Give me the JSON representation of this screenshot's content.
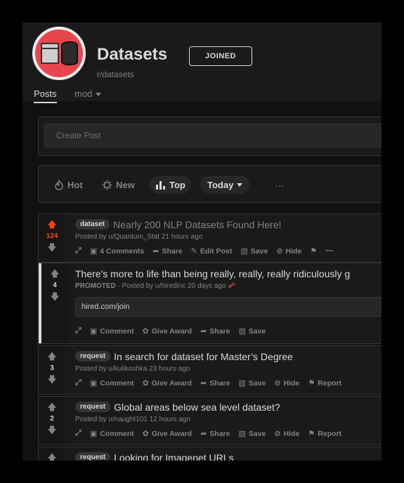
{
  "header": {
    "title": "Datasets",
    "subreddit": "r/datasets",
    "joined_label": "JOINED",
    "tabs": [
      {
        "label": "Posts"
      },
      {
        "label": "mod"
      }
    ]
  },
  "create_post": {
    "placeholder": "Create Post"
  },
  "sort": {
    "hot": "Hot",
    "new": "New",
    "top": "Top",
    "time": "Today",
    "more": "…"
  },
  "posts": [
    {
      "votes": "124",
      "flair": "dataset",
      "title": "Nearly 200 NLP Datasets Found Here!",
      "meta": "Posted by u/Quantum_Stat 21 hours ago",
      "actions": {
        "comments": "4 Comments",
        "share": "Share",
        "edit": "Edit Post",
        "save": "Save",
        "hide": "Hide"
      }
    },
    {
      "votes": "4",
      "title": "There's more to life than being really, really, really ridiculously g",
      "promoted": "PROMOTED",
      "meta": "· Posted by u/hiredinc 20 days ago",
      "link": "hired.com/join",
      "actions": {
        "comment": "Comment",
        "award": "Give Award",
        "share": "Share",
        "save": "Save"
      }
    },
    {
      "votes": "3",
      "flair": "request",
      "title": "In search for dataset for Master’s Degree",
      "meta": "Posted by u/kulikoshka 23 hours ago",
      "actions": {
        "comment": "Comment",
        "award": "Give Award",
        "share": "Share",
        "save": "Save",
        "hide": "Hide",
        "report": "Report"
      }
    },
    {
      "votes": "2",
      "flair": "request",
      "title": "Global areas below sea level dataset?",
      "meta": "Posted by u/naught101 12 hours ago",
      "actions": {
        "comment": "Comment",
        "award": "Give Award",
        "share": "Share",
        "save": "Save",
        "hide": "Hide",
        "report": "Report"
      }
    },
    {
      "flair": "request",
      "title": "Looking for Imagenet URLs"
    }
  ],
  "icons": [
    "subreddit-avatar-icon",
    "flame-icon",
    "new-icon",
    "top-icon",
    "upvote-icon",
    "downvote-icon",
    "expand-icon",
    "comment-icon",
    "share-icon",
    "edit-icon",
    "save-icon",
    "hide-icon",
    "tag-icon",
    "award-icon",
    "report-icon",
    "lock-icon"
  ],
  "colors": {
    "accent": "#ff4500",
    "background": "#1a1a1b",
    "text": "#d7dadc",
    "muted": "#818384"
  }
}
